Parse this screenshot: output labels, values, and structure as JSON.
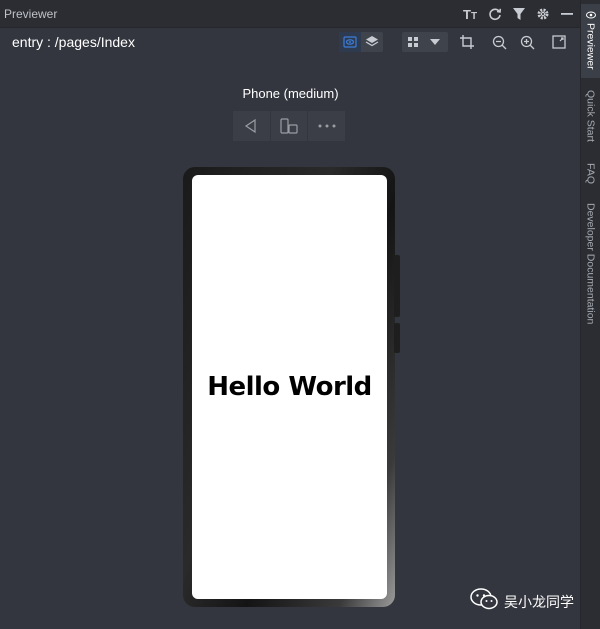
{
  "titlebar": {
    "title": "Previewer",
    "icons": [
      "font-size-icon",
      "refresh-icon",
      "filter-icon",
      "gear-icon",
      "minimize-icon"
    ]
  },
  "toolbar": {
    "path": "entry : /pages/Index",
    "icons": [
      "inspector-eye-icon",
      "layers-icon",
      "grid-view-icon",
      "dropdown-arrow-icon",
      "crop-icon",
      "zoom-out-icon",
      "zoom-in-icon",
      "fit-screen-icon"
    ]
  },
  "sidebar": {
    "tabs": [
      {
        "label": "Previewer",
        "active": true
      },
      {
        "label": "Quick Start"
      },
      {
        "label": "FAQ"
      },
      {
        "label": "Developer Documentation"
      }
    ]
  },
  "device": {
    "name": "Phone (medium)",
    "controls": [
      "back-icon",
      "rotate-icon",
      "more-icon"
    ],
    "screen_text": "Hello World"
  },
  "watermark": {
    "text": "吴小龙同学"
  },
  "colors": {
    "background": "#33363e",
    "bar": "#2b2d33",
    "accent": "#3d7dd8"
  }
}
